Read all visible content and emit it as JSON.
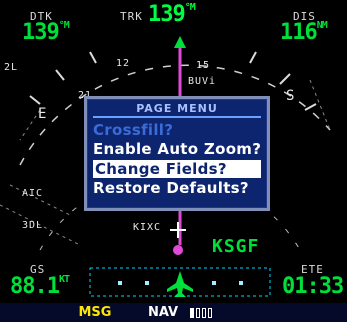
{
  "top_fields": {
    "left": {
      "label": "DTK",
      "value": "139",
      "unit": "°M"
    },
    "center": {
      "label": "TRK",
      "value": "139",
      "unit": "°M"
    },
    "right": {
      "label": "DIS",
      "value": "116",
      "unit": "NM"
    }
  },
  "bottom_fields": {
    "left": {
      "label": "GS",
      "value": "88.1",
      "unit": "KT"
    },
    "right": {
      "label": "ETE",
      "value": "01:33"
    }
  },
  "map": {
    "compass_labels": [
      "12",
      "15",
      "21",
      "S",
      "E"
    ],
    "range_label": "2L",
    "waypoint_buvi": "BUVi",
    "waypoint_aic": "AIC",
    "waypoint_3dl": "3DL",
    "waypoint_kixc": "KIXC",
    "destination": "KSGF"
  },
  "page_menu": {
    "title": "PAGE MENU",
    "items": [
      {
        "label": "Crossfill?",
        "state": "disabled"
      },
      {
        "label": "Enable Auto Zoom?",
        "state": "normal"
      },
      {
        "label": "Change Fields?",
        "state": "selected"
      },
      {
        "label": "Restore Defaults?",
        "state": "normal"
      }
    ]
  },
  "status_bar": {
    "msg": "MSG",
    "mode": "NAV"
  },
  "colors": {
    "field_value": "#00e03a",
    "menu_bg": "#0d246e",
    "msg": "#ffe600",
    "course_line": "#e04ad8"
  }
}
